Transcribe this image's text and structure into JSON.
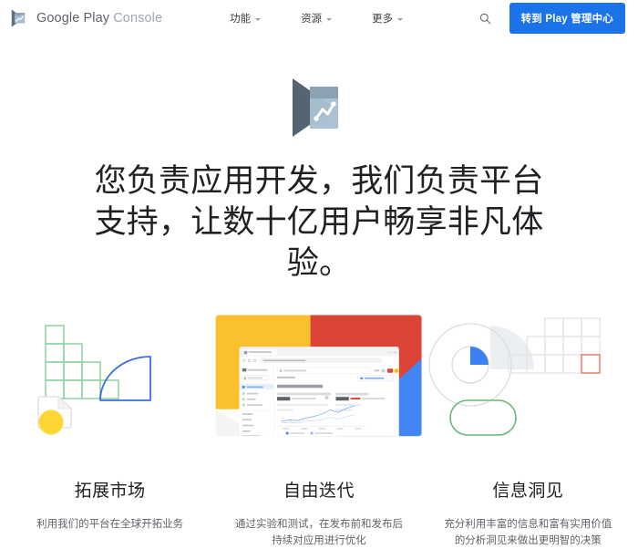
{
  "brand": {
    "logo_icon": "play-console-logo-icon",
    "name_primary": "Google Play",
    "name_secondary": "Console"
  },
  "header": {
    "nav": [
      {
        "label": "功能",
        "icon": "chevron-down-icon"
      },
      {
        "label": "资源",
        "icon": "chevron-down-icon"
      },
      {
        "label": "更多",
        "icon": "chevron-down-icon"
      }
    ],
    "search_icon": "search-icon",
    "cta_label": "转到 Play 管理中心"
  },
  "hero": {
    "icon": "play-console-large-icon",
    "title": "您负责应用开发，我们负责平台支持，让数十亿用户畅享非凡体验。"
  },
  "features": [
    {
      "art": "market-growth-illustration",
      "title": "拓展市场",
      "description": "利用我们的平台在全球开拓业务"
    },
    {
      "art": "play-console-dashboard-illustration",
      "title": "自由迭代",
      "description": "通过实验和测试，在发布前和发布后持续对应用进行优化"
    },
    {
      "art": "insights-illustration",
      "title": "信息洞见",
      "description": "充分利用丰富的信息和富有实用价值的分析洞见来做出更明智的决策"
    }
  ],
  "colors": {
    "accent_blue": "#1a73e8",
    "google_yellow": "#FBBC04",
    "google_red": "#DB4437",
    "google_blue": "#4285F4",
    "google_green": "#5BB974",
    "text_primary": "#202124",
    "text_secondary": "#5f6368"
  }
}
